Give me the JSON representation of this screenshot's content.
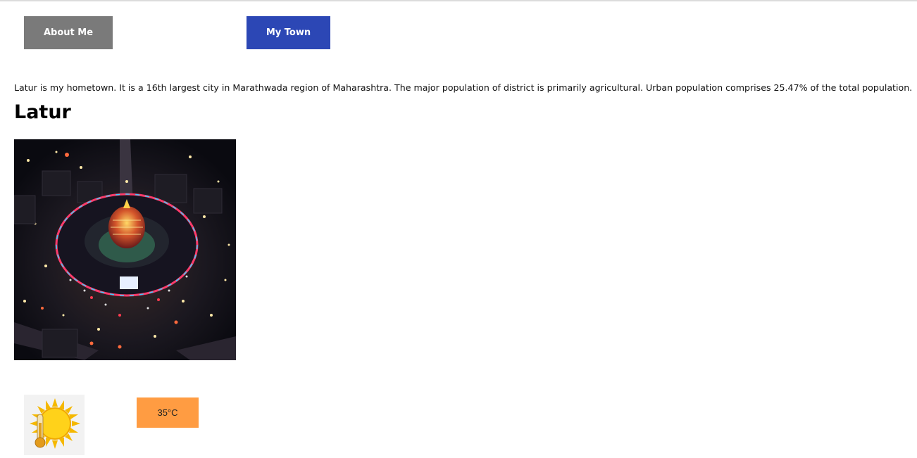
{
  "nav": {
    "about_label": "About Me",
    "town_label": "My Town",
    "about_color": "#7a7a7a",
    "town_color": "#2c47b5"
  },
  "main": {
    "intro_text": "Latur is my hometown. It is a 16th largest city in Marathwada region of Maharashtra. The major population of district is primarily agricultural. Urban population comprises 25.47% of the total population.",
    "heading": "Latur",
    "photo_subject": "aerial night view of Latur city circle"
  },
  "weather": {
    "icon": "sun-thermometer-icon",
    "temperature": "35°C",
    "badge_color": "#ff9c42"
  }
}
